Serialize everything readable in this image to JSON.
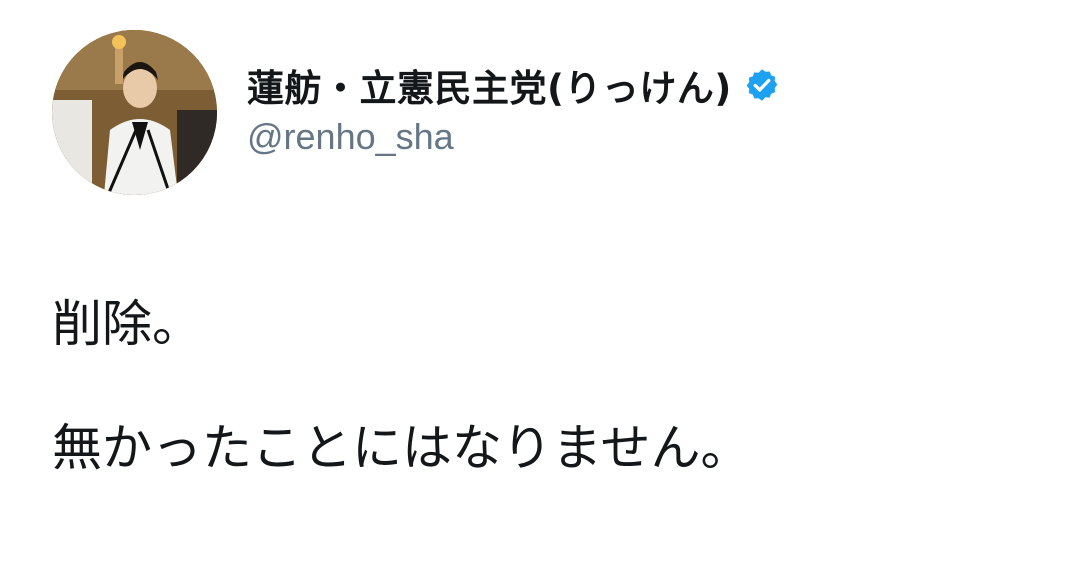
{
  "user": {
    "display_name": "蓮舫・立憲民主党(りっけん)",
    "handle": "@renho_sha",
    "verified": true,
    "verified_color": "#1da1f2"
  },
  "tweet": {
    "lines": [
      "削除。",
      "無かったことにはなりません。"
    ]
  },
  "icons": {
    "avatar": "profile-photo",
    "verified": "verified-badge-icon"
  }
}
